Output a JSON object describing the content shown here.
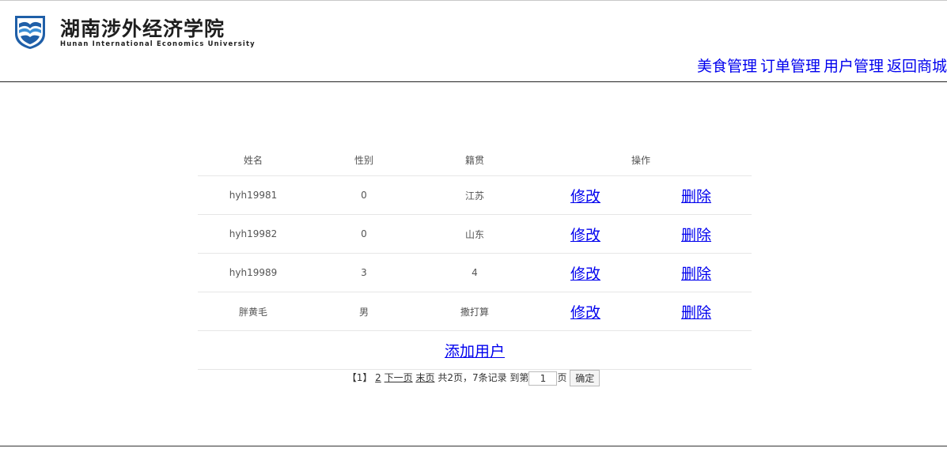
{
  "header": {
    "logo_cn": "湖南涉外经济学院",
    "logo_en": "Hunan International Economics University",
    "nav": [
      "美食管理",
      "订单管理",
      "用户管理",
      "返回商城"
    ]
  },
  "table": {
    "columns": [
      "姓名",
      "性别",
      "籍贯",
      "操作"
    ],
    "rows": [
      {
        "name": "hyh19981",
        "gender": "0",
        "origin": "江苏",
        "edit": "修改",
        "delete": "删除"
      },
      {
        "name": "hyh19982",
        "gender": "0",
        "origin": "山东",
        "edit": "修改",
        "delete": "删除"
      },
      {
        "name": "hyh19989",
        "gender": "3",
        "origin": "4",
        "edit": "修改",
        "delete": "删除"
      },
      {
        "name": "胖黄毛",
        "gender": "男",
        "origin": "撒打算",
        "edit": "修改",
        "delete": "删除"
      }
    ],
    "add_label": "添加用户"
  },
  "pager": {
    "current": "【1】",
    "page2": "2",
    "next": "下一页",
    "last": "末页",
    "summary": "共2页，7条记录",
    "goto_prefix": "到第",
    "goto_value": "1",
    "goto_suffix": "页",
    "confirm": "确定"
  },
  "colors": {
    "link": "#0000ee",
    "logo_blue": "#1f5fa8"
  },
  "icons": {
    "logo": "book-wave-emblem-icon"
  }
}
